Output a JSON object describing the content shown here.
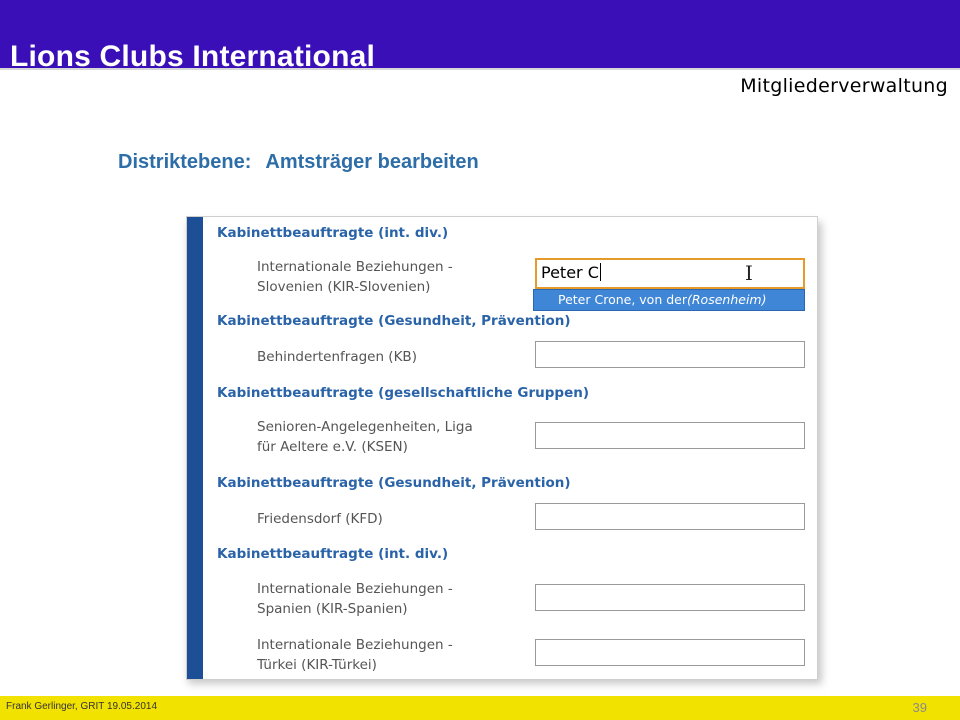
{
  "header": {
    "app_title": "Lions Clubs International",
    "section_title": "Mitgliederverwaltung",
    "bar_color": "#3a0fb7"
  },
  "slide": {
    "heading_level": "Distriktebene:",
    "heading_action": "Amtsträger bearbeiten"
  },
  "form": {
    "groups": [
      {
        "title": "Kabinettbeauftragte (int. div.)"
      },
      {
        "title": "Kabinettbeauftragte (Gesundheit, Prävention)"
      },
      {
        "title": "Kabinettbeauftragte (gesellschaftliche Gruppen)"
      },
      {
        "title": "Kabinettbeauftragte (Gesundheit, Prävention)"
      },
      {
        "title": "Kabinettbeauftragte (int. div.)"
      }
    ],
    "fields": [
      {
        "label_line1": "Internationale Beziehungen -",
        "label_line2": "Slovenien (KIR-Slovenien)",
        "value": "Peter C"
      },
      {
        "label_line1": "Behindertenfragen (KB)",
        "value": ""
      },
      {
        "label_line1": "Senioren-Angelegenheiten, Liga",
        "label_line2": "für Aeltere e.V. (KSEN)",
        "value": ""
      },
      {
        "label_line1": "Friedensdorf (KFD)",
        "value": ""
      },
      {
        "label_line1": "Internationale Beziehungen -",
        "label_line2": "Spanien (KIR-Spanien)",
        "value": ""
      },
      {
        "label_line1": "Internationale Beziehungen -",
        "label_line2": "Türkei (KIR-Türkei)",
        "value": ""
      }
    ],
    "suggestion": {
      "name": "Peter Crone, von der",
      "place": "(Rosenheim)"
    }
  },
  "footer": {
    "author": "Frank Gerlinger, GRIT 19.05.2014",
    "page_number": "39"
  }
}
